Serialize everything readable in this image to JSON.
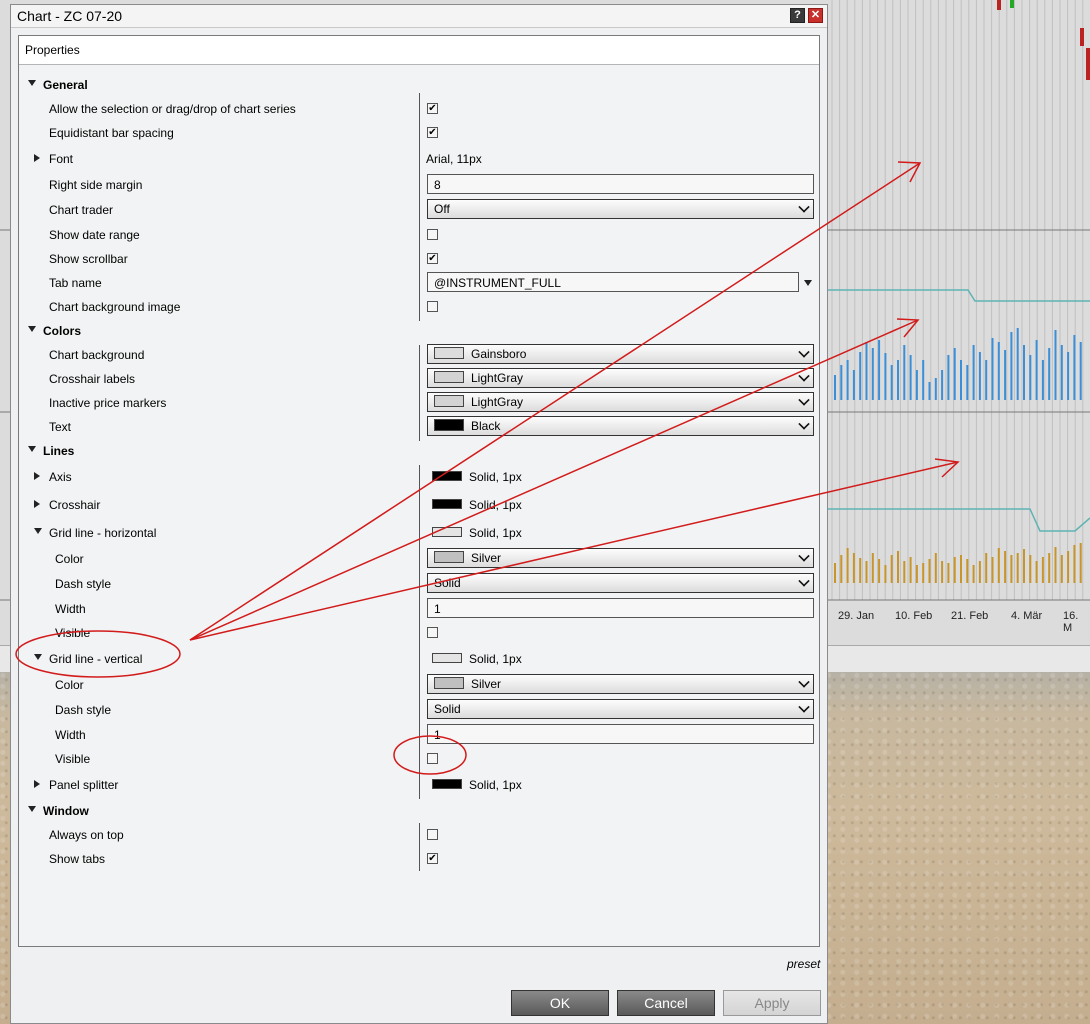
{
  "window": {
    "title": "Chart - ZC 07-20",
    "help_label": "?",
    "close_label": "✕"
  },
  "props_header": "Properties",
  "rows": {
    "general": "General",
    "allow_sel": "Allow the selection or drag/drop of chart series",
    "equidistant": "Equidistant bar spacing",
    "font": "Font",
    "font_value": "Arial, 11px",
    "right_margin": "Right side margin",
    "right_margin_value": "8",
    "chart_trader": "Chart trader",
    "chart_trader_value": "Off",
    "show_date_range": "Show date range",
    "show_scrollbar": "Show scrollbar",
    "tab_name": "Tab name",
    "tab_name_value": "@INSTRUMENT_FULL",
    "chart_bg_image": "Chart background image",
    "colors": "Colors",
    "chart_bg": "Chart background",
    "chart_bg_value": "Gainsboro",
    "crosshair_labels": "Crosshair labels",
    "crosshair_labels_value": "LightGray",
    "inactive_markers": "Inactive price markers",
    "inactive_markers_value": "LightGray",
    "text": "Text",
    "text_value": "Black",
    "lines": "Lines",
    "axis": "Axis",
    "axis_value": "Solid, 1px",
    "crosshair": "Crosshair",
    "crosshair_value": "Solid, 1px",
    "grid_h": "Grid line - horizontal",
    "grid_h_value": "Solid, 1px",
    "color": "Color",
    "grid_h_color": "Silver",
    "dash_style": "Dash style",
    "grid_h_dash": "Solid",
    "width": "Width",
    "grid_h_width": "1",
    "visible": "Visible",
    "grid_v": "Grid line - vertical",
    "grid_v_value": "Solid, 1px",
    "grid_v_color": "Silver",
    "grid_v_dash": "Solid",
    "grid_v_width": "1",
    "panel_splitter": "Panel splitter",
    "panel_splitter_value": "Solid, 1px",
    "window": "Window",
    "always_on_top": "Always on top",
    "show_tabs": "Show tabs"
  },
  "checks": {
    "allow_sel": true,
    "equidistant": true,
    "show_date_range": false,
    "show_scrollbar": true,
    "chart_bg_image": false,
    "grid_h_visible": false,
    "grid_v_visible": false,
    "always_on_top": false,
    "show_tabs": true
  },
  "swatches": {
    "Gainsboro": "#dcdcdc",
    "LightGray": "#d3d3d3",
    "Black": "#000000",
    "Silver": "#c0c0c0"
  },
  "footer": {
    "preset": "preset",
    "ok": "OK",
    "cancel": "Cancel",
    "apply": "Apply"
  },
  "chart_axis_labels": [
    "29. Jan",
    "10. Feb",
    "21. Feb",
    "4. Mär",
    "16. M"
  ],
  "annotation_color": "#d21b1b"
}
